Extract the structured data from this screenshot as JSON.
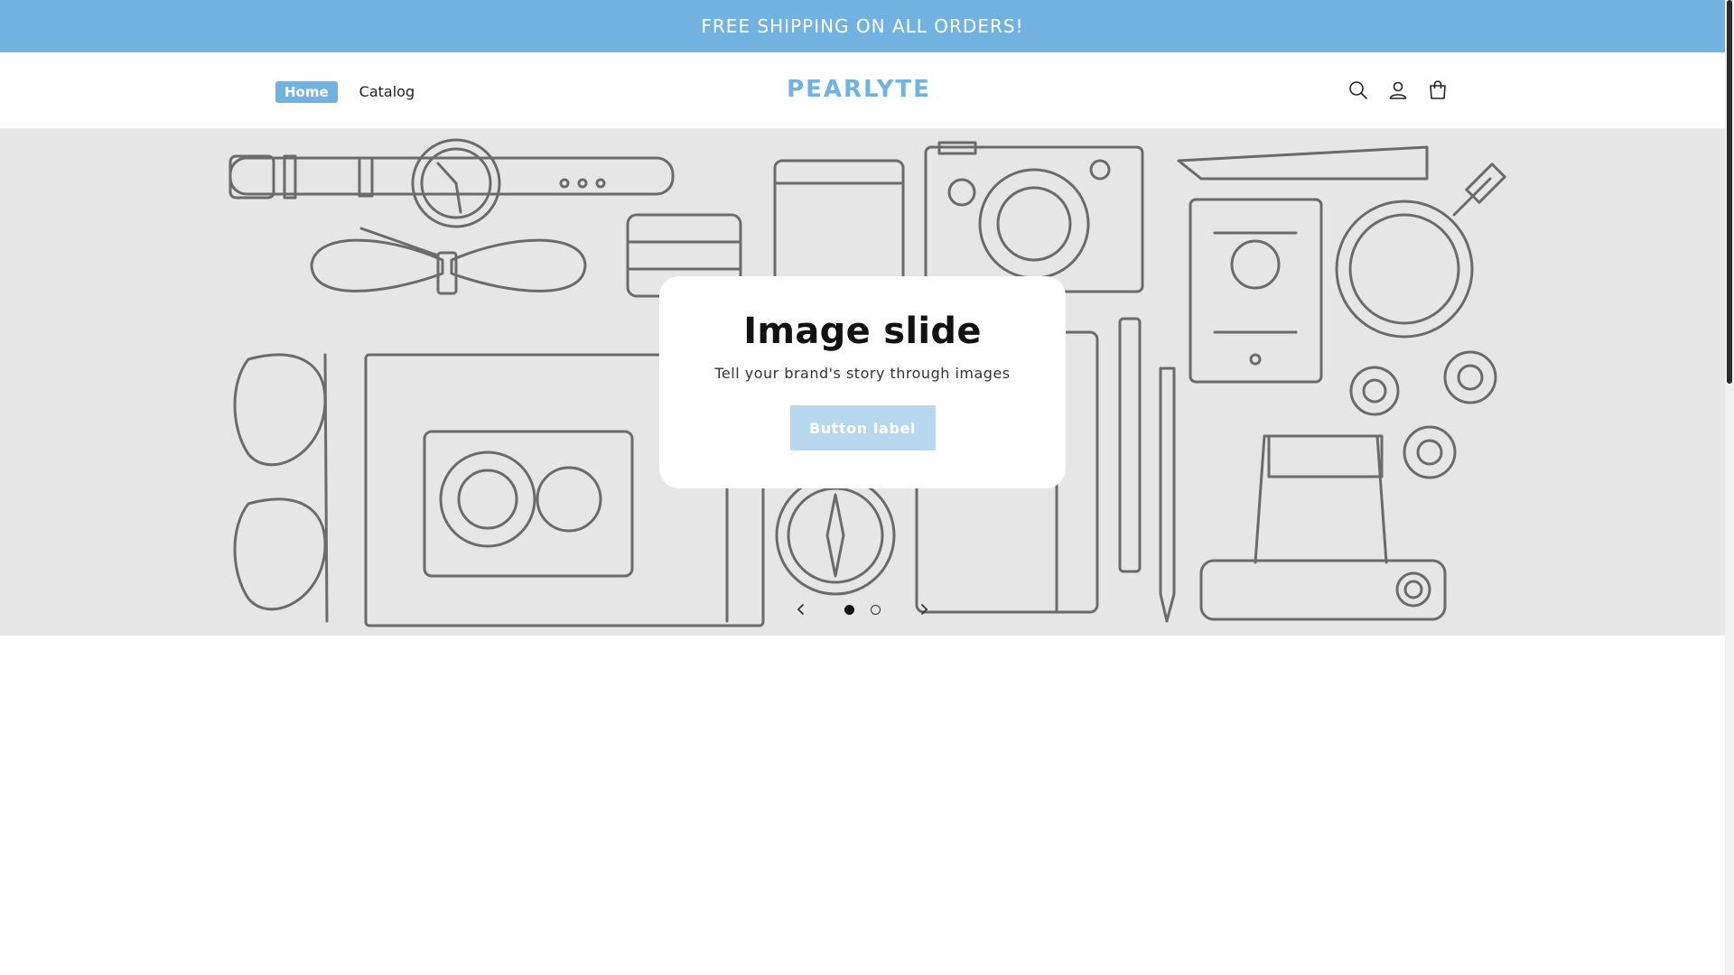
{
  "announcement": {
    "text": "FREE SHIPPING ON ALL ORDERS!"
  },
  "header": {
    "nav": [
      {
        "label": "Home",
        "active": true
      },
      {
        "label": "Catalog",
        "active": false
      }
    ],
    "logo_text": "PEARLYTE",
    "icons": [
      "search-icon",
      "account-icon",
      "cart-icon"
    ]
  },
  "slideshow": {
    "title": "Image slide",
    "subtitle": "Tell your brand's story through images",
    "button_label": "Button label",
    "slide_count": 2,
    "current_slide": 1
  },
  "colors": {
    "accent": "#71b2e0",
    "button_disabled": "#b7d7ef",
    "hero_bg": "#e6e6e6"
  }
}
